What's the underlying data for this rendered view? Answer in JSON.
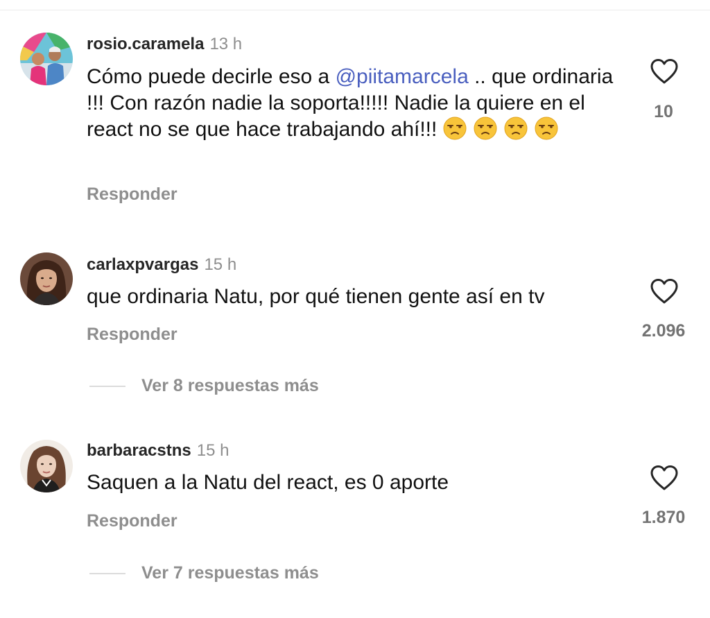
{
  "comments": [
    {
      "username": "rosio.caramela",
      "time": "13 h",
      "text_before": "Cómo puede decirle eso a ",
      "mention": "@piitamarcela",
      "text_after": " .. que ordinaria !!! Con razón nadie la soporta!!!!! Nadie la quiere en el react no se que hace trabajando ahí!!! ",
      "emoji": "unamused-face",
      "emoji_count": 4,
      "reply_label": "Responder",
      "likes": "10",
      "like_icon": "heart-outline-icon"
    },
    {
      "username": "carlaxpvargas",
      "time": "15 h",
      "text": "que ordinaria Natu, por qué tienen gente así en tv",
      "reply_label": "Responder",
      "likes": "2.096",
      "like_icon": "heart-outline-icon",
      "view_replies": "Ver 8 respuestas más"
    },
    {
      "username": "barbaracstns",
      "time": "15 h",
      "text": "Saquen a la Natu del react, es 0 aporte",
      "reply_label": "Responder",
      "likes": "1.870",
      "like_icon": "heart-outline-icon",
      "view_replies": "Ver 7 respuestas más"
    }
  ],
  "colors": {
    "mention": "#4a5fbf",
    "secondary_text": "#8e8e8e",
    "like_count": "#737373",
    "divider": "#dbdbdb"
  }
}
